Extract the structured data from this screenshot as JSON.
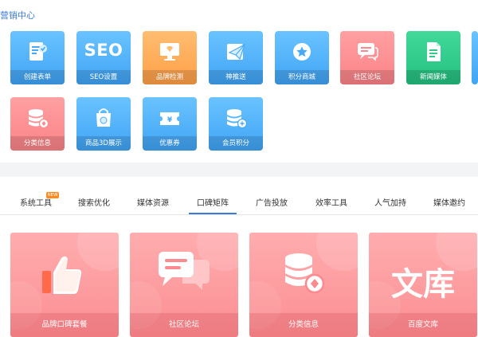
{
  "header": {
    "title": "营销中心"
  },
  "tiles": [
    {
      "label": "创建表单",
      "color": "#48a9f8",
      "icon": "form-icon"
    },
    {
      "label": "SEO设置",
      "color": "#48a9f8",
      "icon": "seo-icon",
      "icon_text": "SEO"
    },
    {
      "label": "品牌检测",
      "color": "#ffa652",
      "icon": "monitor-icon"
    },
    {
      "label": "神推送",
      "color": "#48a9f8",
      "icon": "paper-plane-icon"
    },
    {
      "label": "积分商城",
      "color": "#48a9f8",
      "icon": "star-badge-icon"
    },
    {
      "label": "社区论坛",
      "color": "#fb8a8e",
      "icon": "chat-bubbles-icon"
    },
    {
      "label": "新闻媒体",
      "color": "#2ccb88",
      "icon": "newspaper-icon"
    },
    {
      "label": "分类信息",
      "color": "#fb8a8e",
      "icon": "database-coin-icon"
    },
    {
      "label": "商品3D展示",
      "color": "#48a9f8",
      "icon": "shopping-bag-icon"
    },
    {
      "label": "优惠券",
      "color": "#48a9f8",
      "icon": "coupon-icon"
    },
    {
      "label": "会员积分",
      "color": "#48a9f8",
      "icon": "database-plus-icon"
    }
  ],
  "tabs": [
    {
      "label": "系统工具",
      "badge": "NEW"
    },
    {
      "label": "搜索优化"
    },
    {
      "label": "媒体资源"
    },
    {
      "label": "口碑矩阵",
      "active": true
    },
    {
      "label": "广告投放"
    },
    {
      "label": "效率工具"
    },
    {
      "label": "人气加持"
    },
    {
      "label": "媒体邀约"
    }
  ],
  "cards": [
    {
      "label": "品牌口碑套餐",
      "icon": "thumbs-up-icon"
    },
    {
      "label": "社区论坛",
      "icon": "chat-bubbles-icon"
    },
    {
      "label": "分类信息",
      "icon": "database-coin-icon"
    },
    {
      "label": "百度文库",
      "icon": "wenku-icon",
      "icon_text": "文库"
    }
  ],
  "colors": {
    "accent": "#3b7ad9",
    "tile_blue": "#48a9f8",
    "tile_orange": "#ffa652",
    "tile_pink": "#fb8a8e",
    "tile_green": "#2ccb88",
    "badge": "#ff8a1f"
  }
}
